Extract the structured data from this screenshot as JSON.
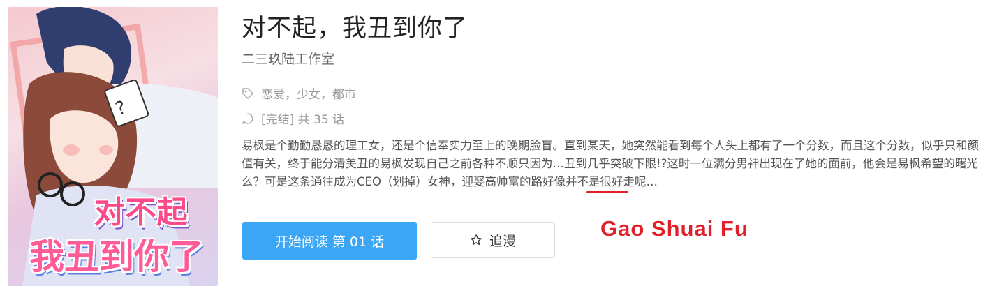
{
  "cover": {
    "title_line1": "对不起",
    "title_line2": "我丑到你了"
  },
  "comic": {
    "title": "对不起，我丑到你了",
    "author": "二三玖陆工作室",
    "tags_text": "恋爱，少女，都市",
    "status_text": "[完结] 共 35 话",
    "description_before": "易枫是个勤勤恳恳的理工女，还是个信奉实力至上的晚期脸盲。直到某天，她突然能看到每个人头上都有了一个分数，而且这个分数，似乎只和颜值有关，终于能分清美丑的易枫发现自己之前各种不顺只因为…丑到几乎突破下限!?这时一位满分男神出现在了她的面前，他会是易枫希望的曙光么？可是这条通往成为CEO（划掉）女神，迎娶",
    "description_highlight": "高帅富",
    "description_after": "的路好像并不是很好走呢…"
  },
  "actions": {
    "read_label": "开始阅读 第 01 话",
    "follow_label": "追漫"
  },
  "annotation": {
    "text": "Gao Shuai Fu",
    "color": "#e0202a"
  },
  "colors": {
    "primary_button": "#3aa6f5",
    "muted_text": "#999999"
  },
  "icons": {
    "tag": "tag-icon",
    "status": "status-icon",
    "star": "star-outline-icon"
  }
}
